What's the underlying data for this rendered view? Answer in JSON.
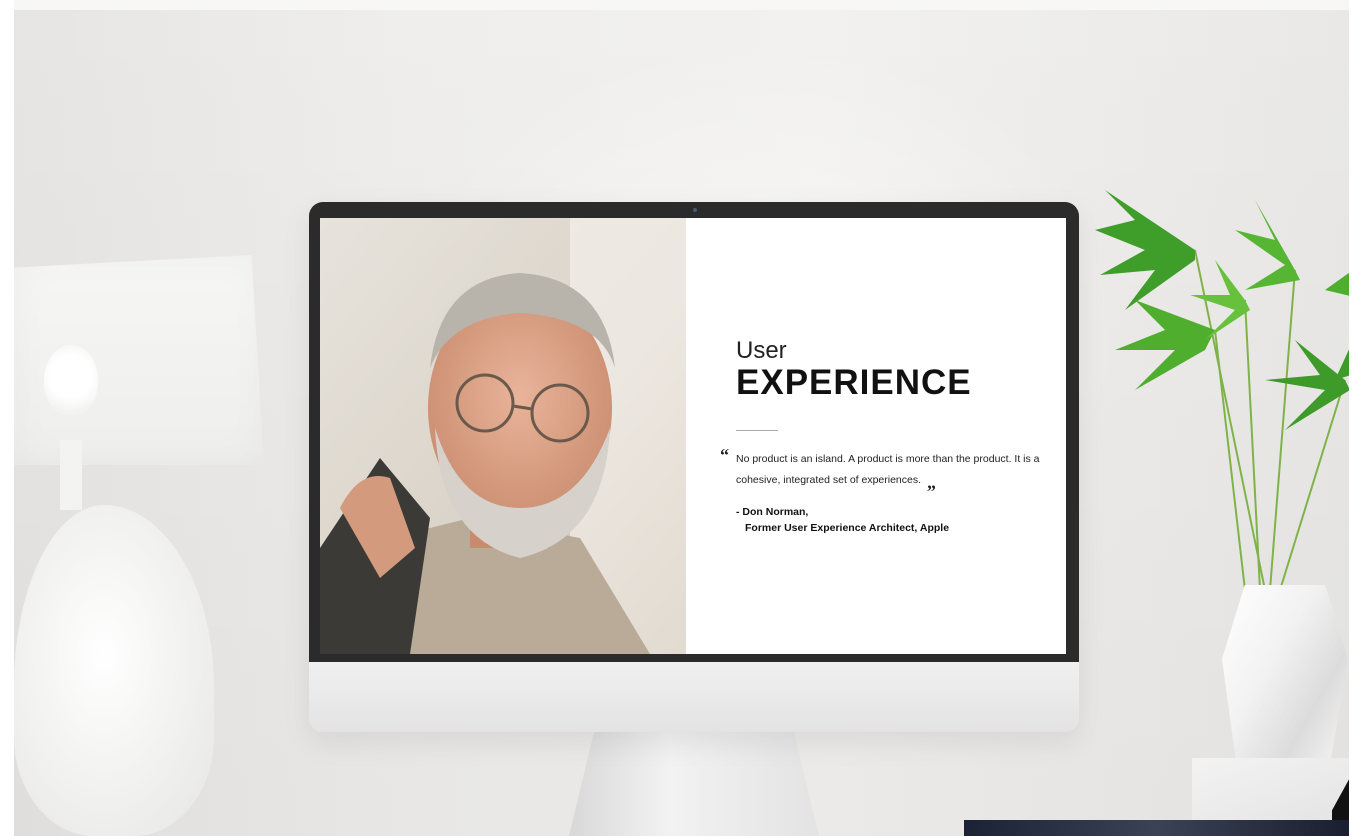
{
  "slide": {
    "heading_small": "User",
    "heading_large": "EXPERIENCE",
    "quote_open": "“",
    "quote_text": "No product is an island. A product is more than the product. It is a cohesive, integrated set of experiences.",
    "quote_close": "„",
    "author_line1": "- Don Norman,",
    "author_line2": "Former User Experience Architect, Apple"
  },
  "colors": {
    "wall": "#eeede b",
    "bezel": "#2b2b2c",
    "plant_green": "#4fae2e"
  }
}
